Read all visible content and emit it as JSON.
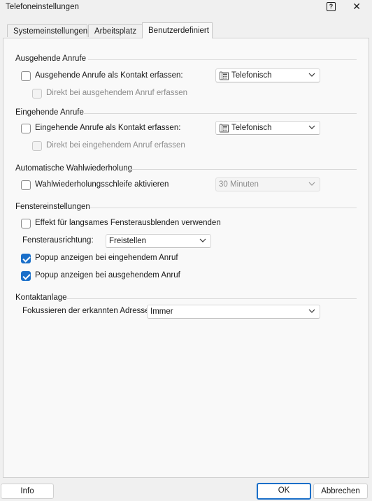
{
  "window": {
    "title": "Telefoneinstellungen",
    "help_label": "?",
    "close_label": "✕"
  },
  "tabs": [
    {
      "label": "Systemeinstellungen"
    },
    {
      "label": "Arbeitsplatz"
    },
    {
      "label": "Benutzerdefiniert"
    }
  ],
  "outgoing": {
    "title": "Ausgehende Anrufe",
    "capture_label": "Ausgehende Anrufe als Kontakt erfassen:",
    "capture_checked": false,
    "mode_value": "Telefonisch",
    "direct_label": "Direkt bei ausgehendem Anruf erfassen",
    "direct_checked": false
  },
  "incoming": {
    "title": "Eingehende Anrufe",
    "capture_label": "Eingehende Anrufe als Kontakt erfassen:",
    "capture_checked": false,
    "mode_value": "Telefonisch",
    "direct_label": "Direkt bei eingehendem Anruf erfassen",
    "direct_checked": false
  },
  "redial": {
    "title": "Automatische Wahlwiederholung",
    "loop_label": "Wahlwiederholungsschleife aktivieren",
    "loop_checked": false,
    "interval_value": "30 Minuten"
  },
  "window_settings": {
    "title": "Fenstereinstellungen",
    "fade_label": "Effekt für langsames Fensterausblenden verwenden",
    "fade_checked": false,
    "alignment_label": "Fensterausrichtung:",
    "alignment_value": "Freistellen",
    "popup_incoming_label": "Popup anzeigen bei eingehendem Anruf",
    "popup_incoming_checked": true,
    "popup_outgoing_label": "Popup anzeigen bei ausgehendem Anruf",
    "popup_outgoing_checked": true
  },
  "contact": {
    "title": "Kontaktanlage",
    "focus_label": "Fokussieren der erkannten Adresse:",
    "focus_value": "Immer"
  },
  "footer": {
    "info_label": "Info",
    "ok_label": "OK",
    "cancel_label": "Abbrechen"
  },
  "colors": {
    "accent": "#1a6fc9",
    "window_bg": "#f0f0f0",
    "panel_bg": "#f9f9f9"
  }
}
